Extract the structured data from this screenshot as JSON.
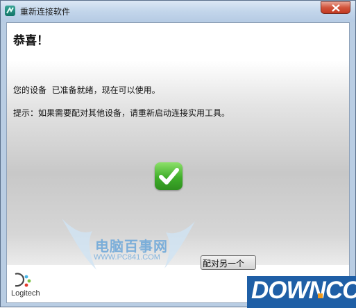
{
  "window": {
    "title": "重新连接软件",
    "close_icon": "close-icon"
  },
  "header": {
    "title": "恭喜！"
  },
  "main": {
    "message1": "您的设备  已准备就绪，现在可以使用。",
    "message2": "提示：如果需要配对其他设备，请重新启动连接实用工具。",
    "status_icon": "checkmark-icon",
    "status_color": "#3fae2a"
  },
  "footer": {
    "logo_text": "Logitech",
    "next_button_label": "配对另一个"
  },
  "watermark": {
    "chinese": "电脑百事网",
    "url": "WWW.PC841.COM"
  },
  "brand": {
    "text": "DOWN",
    "suffix": "CC"
  }
}
